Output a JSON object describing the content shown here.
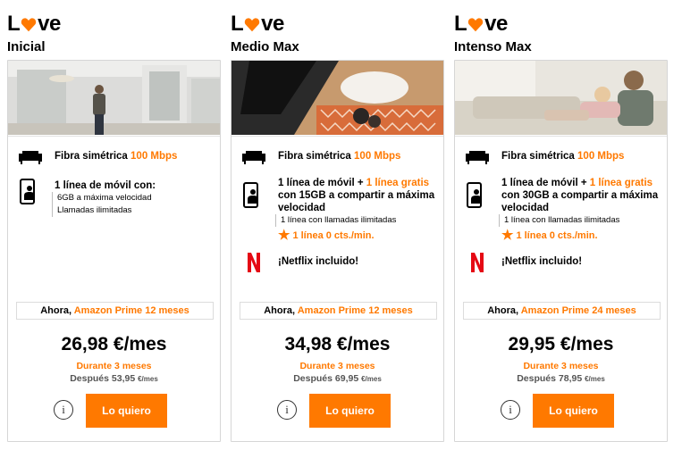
{
  "brand": {
    "letter_first": "L",
    "letters_rest": "ve",
    "heart_color": "#ff7900"
  },
  "colors": {
    "accent": "#ff7900",
    "border": "#d6d6d6",
    "text": "#000000"
  },
  "plans": [
    {
      "name": "Inicial",
      "fiber_label": "Fibra simétrica",
      "fiber_speed": "100 Mbps",
      "mobile_line": "1 línea de móvil con:",
      "mobile_extra": "",
      "mobile_rest": "",
      "sub1": "6GB a máxima velocidad",
      "sub2": "Llamadas ilimitadas",
      "star_text": "",
      "netflix": "",
      "promo_prefix": "Ahora,",
      "promo_offer": "Amazon Prime 12 meses",
      "price": "26,98 €/mes",
      "during": "Durante 3 meses",
      "after_label": "Después 53,95",
      "after_unit": "€/mes",
      "info_label": "i",
      "cta": "Lo quiero"
    },
    {
      "name": "Medio Max",
      "fiber_label": "Fibra simétrica",
      "fiber_speed": "100 Mbps",
      "mobile_line": "1 línea de móvil +",
      "mobile_extra": "1 línea gratis",
      "mobile_rest": "con 15GB a compartir a máxima velocidad",
      "sub1": "1 línea con llamadas ilimitadas",
      "sub2": "",
      "star_text": "1 línea 0 cts./min.",
      "netflix": "¡Netflix incluido!",
      "promo_prefix": "Ahora,",
      "promo_offer": "Amazon Prime 12 meses",
      "price": "34,98 €/mes",
      "during": "Durante 3 meses",
      "after_label": "Después 69,95",
      "after_unit": "€/mes",
      "info_label": "i",
      "cta": "Lo quiero"
    },
    {
      "name": "Intenso Max",
      "fiber_label": "Fibra simétrica",
      "fiber_speed": "100 Mbps",
      "mobile_line": "1 línea de móvil +",
      "mobile_extra": "1 línea gratis",
      "mobile_rest": "con 30GB a compartir a máxima velocidad",
      "sub1": "1 línea con llamadas ilimitadas",
      "sub2": "",
      "star_text": "1 línea 0 cts./min.",
      "netflix": "¡Netflix incluido!",
      "promo_prefix": "Ahora,",
      "promo_offer": "Amazon Prime 24 meses",
      "price": "29,95 €/mes",
      "during": "Durante 3 meses",
      "after_label": "Después 78,95",
      "after_unit": "€/mes",
      "info_label": "i",
      "cta": "Lo quiero"
    }
  ],
  "icons": {
    "sofa": "sofa-icon",
    "phone": "mobile-phone-icon",
    "netflix": "netflix-logo-icon",
    "star": "star-icon",
    "info": "info-icon"
  }
}
